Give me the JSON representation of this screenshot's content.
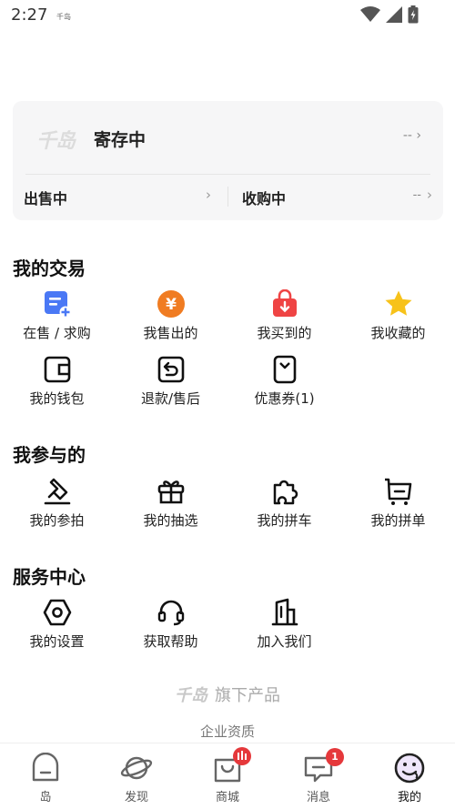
{
  "status_bar": {
    "time": "2:27",
    "mini_label": "千岛"
  },
  "storage_card": {
    "logo_text": "千岛",
    "title": "寄存中",
    "value": "--",
    "selling": {
      "label": "出售中",
      "chevron": "›"
    },
    "buying": {
      "label": "收购中",
      "value": "--",
      "chevron": "›"
    }
  },
  "trading": {
    "title": "我的交易",
    "items": [
      {
        "label": "在售 / 求购",
        "icon": "document-plus-icon"
      },
      {
        "label": "我售出的",
        "icon": "yuan-coin-icon"
      },
      {
        "label": "我买到的",
        "icon": "shopping-bag-icon"
      },
      {
        "label": "我收藏的",
        "icon": "star-icon"
      },
      {
        "label": "我的钱包",
        "icon": "wallet-icon"
      },
      {
        "label": "退款/售后",
        "icon": "refund-icon"
      },
      {
        "label": "优惠券(1)",
        "icon": "coupon-icon"
      }
    ]
  },
  "participation": {
    "title": "我参与的",
    "items": [
      {
        "label": "我的参拍",
        "icon": "gavel-icon"
      },
      {
        "label": "我的抽选",
        "icon": "gift-icon"
      },
      {
        "label": "我的拼车",
        "icon": "puzzle-icon"
      },
      {
        "label": "我的拼单",
        "icon": "cart-icon"
      }
    ]
  },
  "service": {
    "title": "服务中心",
    "items": [
      {
        "label": "我的设置",
        "icon": "hexagon-settings-icon"
      },
      {
        "label": "获取帮助",
        "icon": "headset-icon"
      },
      {
        "label": "加入我们",
        "icon": "building-icon"
      }
    ]
  },
  "footer": {
    "brand_logo": "千岛",
    "brand_suffix": "旗下产品",
    "qualification_link": "企业资质"
  },
  "tab_bar": {
    "tabs": [
      {
        "label": "岛",
        "icon": "island-home-icon"
      },
      {
        "label": "发现",
        "icon": "planet-icon"
      },
      {
        "label": "商城",
        "icon": "mall-bag-icon",
        "badge": "live"
      },
      {
        "label": "消息",
        "icon": "message-icon",
        "badge": "1"
      },
      {
        "label": "我的",
        "icon": "profile-face-icon",
        "active": true
      }
    ]
  },
  "colors": {
    "accent_orange": "#f07c22",
    "accent_red": "#ef4444",
    "accent_blue": "#4a78f5",
    "accent_yellow": "#f7c21a",
    "badge_red": "#e5383b"
  }
}
